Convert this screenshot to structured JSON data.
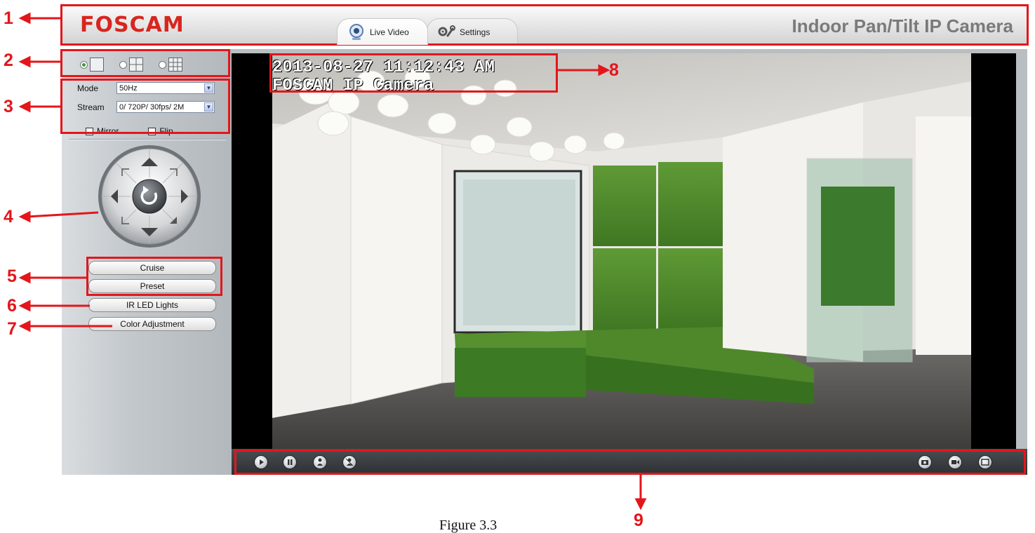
{
  "header": {
    "logo": "FOSCAM",
    "tabs": [
      {
        "label": "Live Video",
        "icon": "webcam-icon",
        "active": true
      },
      {
        "label": "Settings",
        "icon": "wrench-gear-icon",
        "active": false
      }
    ],
    "camera_title": "Indoor Pan/Tilt IP Camera"
  },
  "left_panel": {
    "layouts": [
      {
        "name": "single-view-icon",
        "selected": true
      },
      {
        "name": "quad-view-icon",
        "selected": false
      },
      {
        "name": "nine-view-icon",
        "selected": false
      }
    ],
    "mode": {
      "label": "Mode",
      "value": "50Hz"
    },
    "stream": {
      "label": "Stream",
      "value": "0/ 720P/ 30fps/ 2M"
    },
    "mirror": {
      "label": "Mirror",
      "checked": false
    },
    "flip": {
      "label": "Flip",
      "checked": false
    },
    "buttons": {
      "cruise": "Cruise",
      "preset": "Preset",
      "ir": "IR LED Lights",
      "color": "Color Adjustment"
    }
  },
  "video": {
    "osd_datetime": "2013-08-27 11:12:43 AM",
    "osd_name": "FOSCAM IP Camera"
  },
  "toolbar": {
    "left_icons": [
      "play-icon",
      "stop-icon",
      "talk-icon",
      "audio-icon"
    ],
    "right_icons": [
      "snapshot-icon",
      "record-icon",
      "fullscreen-icon"
    ]
  },
  "annotations": [
    "1",
    "2",
    "3",
    "4",
    "5",
    "6",
    "7",
    "8",
    "9"
  ],
  "caption": "Figure 3.3",
  "colors": {
    "annotation": "#e3161b",
    "logo": "#d7261e",
    "grass": "#4f8a2c"
  }
}
